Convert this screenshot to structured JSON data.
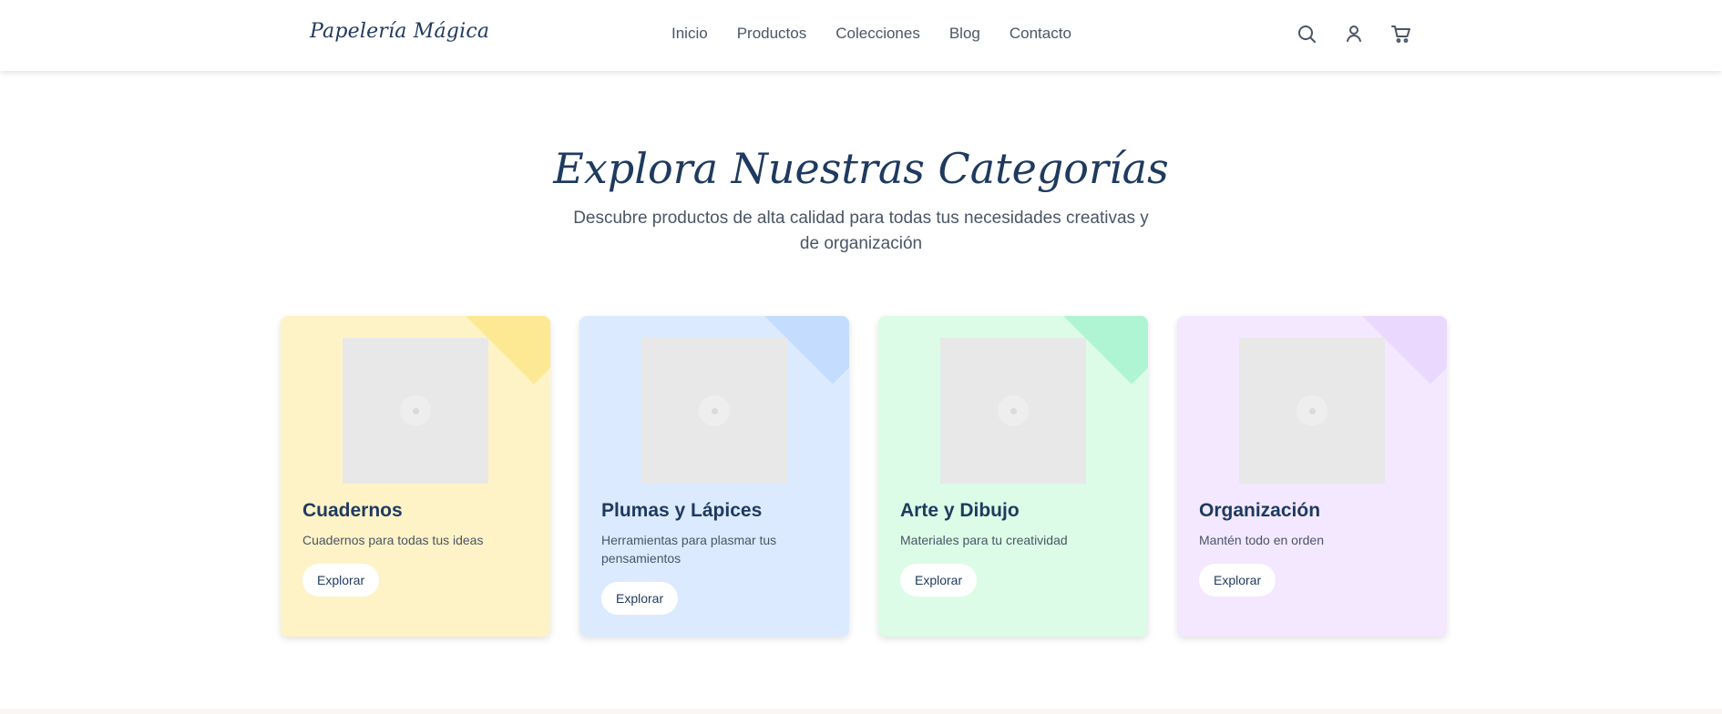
{
  "header": {
    "logo": "Papelería Mágica",
    "nav": [
      "Inicio",
      "Productos",
      "Colecciones",
      "Blog",
      "Contacto"
    ],
    "icons": [
      "search-icon",
      "user-icon",
      "cart-icon"
    ]
  },
  "hero": {
    "title": "Explora Nuestras Categorías",
    "subtitle": "Descubre productos de alta calidad para todas tus necesidades creativas y de organización"
  },
  "categories": [
    {
      "title": "Cuadernos",
      "description": "Cuadernos para todas tus ideas",
      "button": "Explorar",
      "bg": "#fef3c7",
      "accent": "#fde68a"
    },
    {
      "title": "Plumas y Lápices",
      "description": "Herramientas para plasmar tus pensamientos",
      "button": "Explorar",
      "bg": "#dbeafe",
      "accent": "#bfdbfe"
    },
    {
      "title": "Arte y Dibujo",
      "description": "Materiales para tu creatividad",
      "button": "Explorar",
      "bg": "#dcfce7",
      "accent": "#a7f3d0"
    },
    {
      "title": "Organización",
      "description": "Mantén todo en orden",
      "button": "Explorar",
      "bg": "#f3e8ff",
      "accent": "#e9d5ff"
    }
  ]
}
